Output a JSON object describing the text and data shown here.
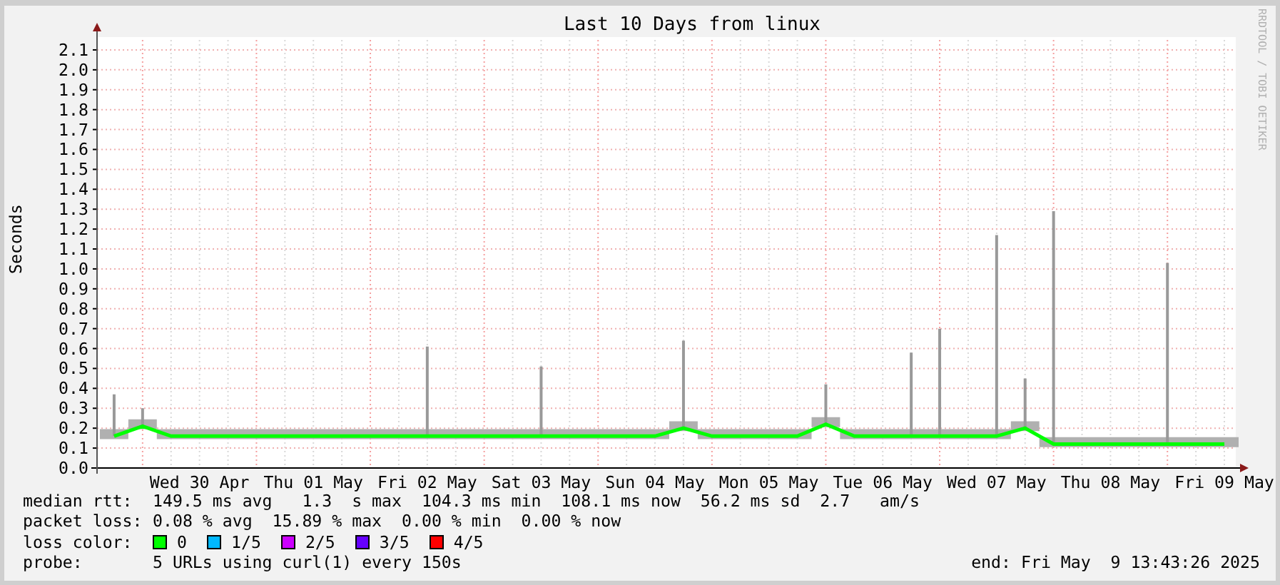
{
  "graph": {
    "title": "Last 10 Days from linux",
    "credit": "RRDTOOL / TOBI OETIKER",
    "chart_data": {
      "type": "line",
      "ylabel": "Seconds",
      "categories": [
        null,
        null,
        null,
        "Wed 30 Apr",
        null,
        null,
        null,
        "Thu 01 May",
        null,
        null,
        null,
        "Fri 02 May",
        null,
        null,
        null,
        "Sat 03 May",
        null,
        null,
        null,
        "Sun 04 May",
        null,
        null,
        null,
        "Mon 05 May",
        null,
        null,
        null,
        "Tue 06 May",
        null,
        null,
        null,
        "Wed 07 May",
        null,
        null,
        null,
        "Thu 08 May",
        null,
        null,
        null,
        "Fri 09 May"
      ],
      "ylim": [
        0,
        2.15
      ],
      "yticks": [
        {
          "value": 0,
          "label": "0.0"
        },
        {
          "value": 0.1,
          "label": "0.1"
        },
        {
          "value": 0.2,
          "label": "0.2"
        },
        {
          "value": 0.3,
          "label": "0.3"
        },
        {
          "value": 0.4,
          "label": "0.4"
        },
        {
          "value": 0.5,
          "label": "0.5"
        },
        {
          "value": 0.6,
          "label": "0.6"
        },
        {
          "value": 0.7,
          "label": "0.7"
        },
        {
          "value": 0.8,
          "label": "0.8"
        },
        {
          "value": 0.9,
          "label": "0.9"
        },
        {
          "value": 1.0,
          "label": "1.0"
        },
        {
          "value": 1.1,
          "label": "1.1"
        },
        {
          "value": 1.2,
          "label": "1.2"
        },
        {
          "value": 1.3,
          "label": "1.3"
        },
        {
          "value": 1.4,
          "label": "1.4"
        },
        {
          "value": 1.5,
          "label": "1.5"
        },
        {
          "value": 1.6,
          "label": "1.6"
        },
        {
          "value": 1.7,
          "label": "1.7"
        },
        {
          "value": 1.8,
          "label": "1.8"
        },
        {
          "value": 1.9,
          "label": "1.9"
        },
        {
          "value": 2.0,
          "label": "2.0"
        },
        {
          "value": 2.1,
          "label": "2.1"
        }
      ],
      "grid": true,
      "series": [
        {
          "color": "#00ff00",
          "values": [
            0.16,
            0.21,
            0.16,
            0.16,
            0.16,
            0.16,
            0.16,
            0.16,
            0.16,
            0.16,
            0.16,
            0.16,
            0.16,
            0.16,
            0.16,
            0.16,
            0.16,
            0.16,
            0.16,
            0.16,
            0.2,
            0.16,
            0.16,
            0.16,
            0.16,
            0.22,
            0.16,
            0.16,
            0.16,
            0.16,
            0.16,
            0.16,
            0.2,
            0.12,
            0.12,
            0.12,
            0.12,
            0.12,
            0.12,
            0.12
          ]
        }
      ]
    }
  },
  "legend": {
    "rows": [
      {
        "label": "median rtt:",
        "stats": "149.5 ms avg   1.3  s max  104.3 ms min  108.1 ms now  56.2 ms sd  2.7   am/s"
      },
      {
        "label": "packet loss:",
        "stats": "0.08 % avg  15.89 % max  0.00 % min  0.00 % now"
      }
    ],
    "loss_color_label": "loss color:",
    "loss_colors": [
      {
        "label": "0",
        "color": "#00ff00"
      },
      {
        "label": "1/5",
        "color": "#00b8ff"
      },
      {
        "label": "2/5",
        "color": "#cc00ff"
      },
      {
        "label": "3/5",
        "color": "#6600ff"
      },
      {
        "label": "4/5",
        "color": "#ff0000"
      }
    ],
    "probe_label": "probe:",
    "probe": "5 URLs using curl(1) every 150s",
    "end": "end: Fri May  9 13:43:26 2025"
  }
}
